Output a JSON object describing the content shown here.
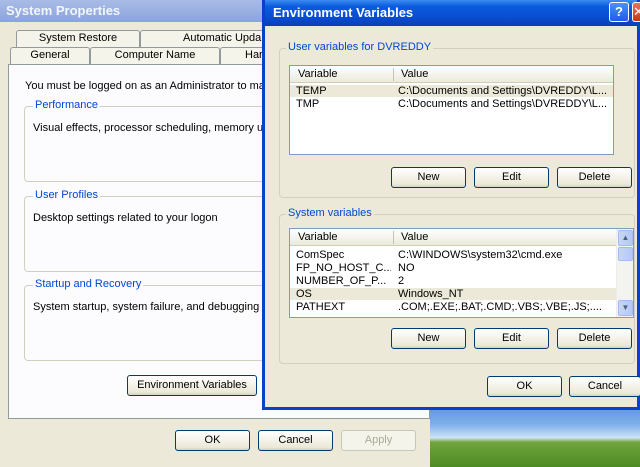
{
  "system_properties": {
    "title": "System Properties",
    "tabs_top": [
      "System Restore",
      "Automatic Upda"
    ],
    "tabs_bottom": [
      "General",
      "Computer Name",
      "Har"
    ],
    "admin_note": "You must be logged on as an Administrator to mak",
    "groups": [
      {
        "label": "Performance",
        "text": "Visual effects, processor scheduling, memory us"
      },
      {
        "label": "User Profiles",
        "text": "Desktop settings related to your logon"
      },
      {
        "label": "Startup and Recovery",
        "text": "System startup, system failure, and debugging in"
      }
    ],
    "env_button": "Environment Variables",
    "ok": "OK",
    "cancel": "Cancel",
    "apply": "Apply"
  },
  "env_dialog": {
    "title": "Environment Variables",
    "help_glyph": "?",
    "close_glyph": "✕",
    "user_section": {
      "label": "User variables for DVREDDY",
      "columns": [
        "Variable",
        "Value"
      ],
      "rows": [
        {
          "variable": "TEMP",
          "value": "C:\\Documents and Settings\\DVREDDY\\L..."
        },
        {
          "variable": "TMP",
          "value": "C:\\Documents and Settings\\DVREDDY\\L..."
        }
      ],
      "new": "New",
      "edit": "Edit",
      "delete": "Delete"
    },
    "system_section": {
      "label": "System variables",
      "columns": [
        "Variable",
        "Value"
      ],
      "rows": [
        {
          "variable": "ComSpec",
          "value": "C:\\WINDOWS\\system32\\cmd.exe"
        },
        {
          "variable": "FP_NO_HOST_C...",
          "value": "NO"
        },
        {
          "variable": "NUMBER_OF_P...",
          "value": "2"
        },
        {
          "variable": "OS",
          "value": "Windows_NT"
        },
        {
          "variable": "PATHEXT",
          "value": ".COM;.EXE;.BAT;.CMD;.VBS;.VBE;.JS;...."
        }
      ],
      "new": "New",
      "edit": "Edit",
      "delete": "Delete"
    },
    "ok": "OK",
    "cancel": "Cancel"
  }
}
